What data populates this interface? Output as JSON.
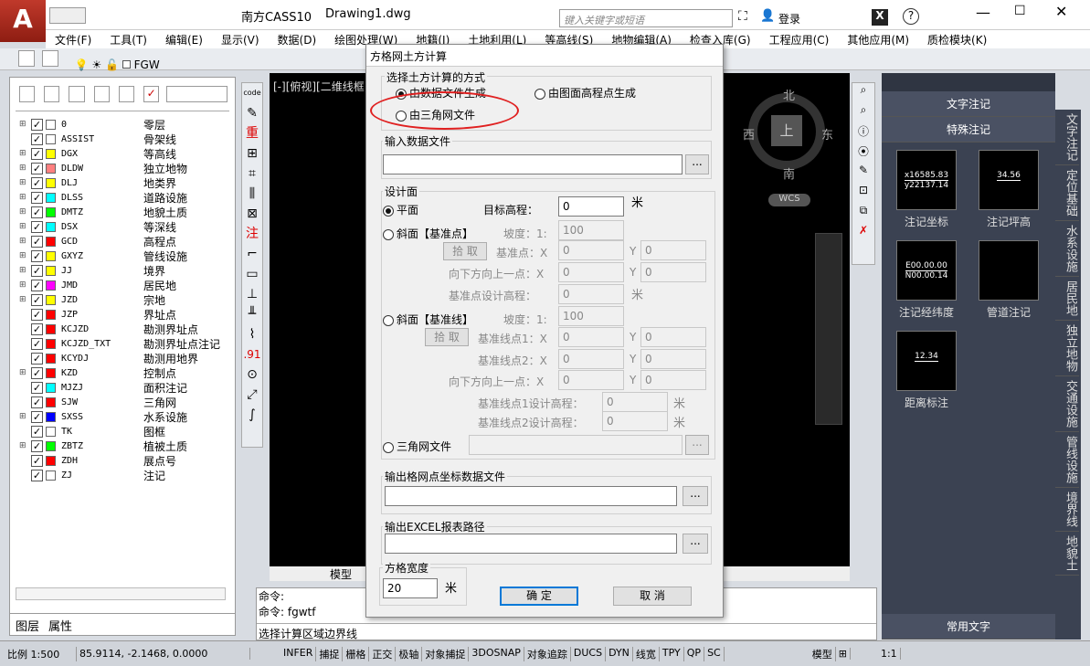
{
  "app": {
    "title": "南方CASS10",
    "file": "Drawing1.dwg",
    "search_placeholder": "键入关键字或短语",
    "login": "登录"
  },
  "menus": [
    "文件(F)",
    "工具(T)",
    "编辑(E)",
    "显示(V)",
    "数据(D)",
    "绘图处理(W)",
    "地籍(J)",
    "土地利用(L)",
    "等高线(S)",
    "地物编辑(A)",
    "检查入库(G)",
    "工程应用(C)",
    "其他应用(M)",
    "质检模块(K)"
  ],
  "layer_combo": "FGW",
  "layers": [
    {
      "name": "0",
      "desc": "零层",
      "color": "#ffffff",
      "plus": true
    },
    {
      "name": "ASSIST",
      "desc": "骨架线",
      "color": "#ffffff",
      "plus": false
    },
    {
      "name": "DGX",
      "desc": "等高线",
      "color": "#ffff00",
      "plus": true
    },
    {
      "name": "DLDW",
      "desc": "独立地物",
      "color": "#ff8080",
      "plus": true
    },
    {
      "name": "DLJ",
      "desc": "地类界",
      "color": "#ffff00",
      "plus": true
    },
    {
      "name": "DLSS",
      "desc": "道路设施",
      "color": "#00ffff",
      "plus": true
    },
    {
      "name": "DMTZ",
      "desc": "地貌土质",
      "color": "#00ff00",
      "plus": true
    },
    {
      "name": "DSX",
      "desc": "等深线",
      "color": "#00ffff",
      "plus": true
    },
    {
      "name": "GCD",
      "desc": "高程点",
      "color": "#ff0000",
      "plus": true
    },
    {
      "name": "GXYZ",
      "desc": "管线设施",
      "color": "#ffff00",
      "plus": true
    },
    {
      "name": "JJ",
      "desc": "境界",
      "color": "#ffff00",
      "plus": true
    },
    {
      "name": "JMD",
      "desc": "居民地",
      "color": "#ff00ff",
      "plus": true
    },
    {
      "name": "JZD",
      "desc": "宗地",
      "color": "#ffff00",
      "plus": true
    },
    {
      "name": "JZP",
      "desc": "界址点",
      "color": "#ff0000",
      "plus": false
    },
    {
      "name": "KCJZD",
      "desc": "勘测界址点",
      "color": "#ff0000",
      "plus": false
    },
    {
      "name": "KCJZD_TXT",
      "desc": "勘测界址点注记",
      "color": "#ff0000",
      "plus": false
    },
    {
      "name": "KCYDJ",
      "desc": "勘测用地界",
      "color": "#ff0000",
      "plus": false
    },
    {
      "name": "KZD",
      "desc": "控制点",
      "color": "#ff0000",
      "plus": true
    },
    {
      "name": "MJZJ",
      "desc": "面积注记",
      "color": "#00ffff",
      "plus": false
    },
    {
      "name": "SJW",
      "desc": "三角网",
      "color": "#ff0000",
      "plus": false
    },
    {
      "name": "SXSS",
      "desc": "水系设施",
      "color": "#0000ff",
      "plus": true
    },
    {
      "name": "TK",
      "desc": "图框",
      "color": "#ffffff",
      "plus": false
    },
    {
      "name": "ZBTZ",
      "desc": "植被土质",
      "color": "#00ff00",
      "plus": true
    },
    {
      "name": "ZDH",
      "desc": "展点号",
      "color": "#ff0000",
      "plus": false
    },
    {
      "name": "ZJ",
      "desc": "注记",
      "color": "#ffffff",
      "plus": false
    }
  ],
  "left_tabs": {
    "layers": "图层",
    "props": "属性"
  },
  "viewport": {
    "label": "[-][俯视][二维线框]",
    "tab_model": "模型"
  },
  "viewcube": {
    "north": "北",
    "south": "南",
    "east": "东",
    "west": "西",
    "top": "上",
    "wcs": "WCS"
  },
  "dialog": {
    "title": "方格网土方计算",
    "method_group": "选择土方计算的方式",
    "opt_data_file": "由数据文件生成",
    "opt_elev_points": "由图面高程点生成",
    "opt_tin_file": "由三角网文件",
    "input_group": "输入数据文件",
    "browse": "...",
    "design_group": "设计面",
    "plane": "平面",
    "target_elev": "目标高程：",
    "target_elev_val": "0",
    "unit_m": "米",
    "slope_base_point": "斜面【基准点】",
    "slope_label": "坡度：1:",
    "slope_val": "100",
    "pick": "拾 取",
    "base_point": "基准点：X",
    "y_label": "Y",
    "zero": "0",
    "down_point": "向下方向上一点：X",
    "base_point_design": "基准点设计高程：",
    "slope_base_line": "斜面【基准线】",
    "base_line1": "基准线点1：X",
    "base_line2": "基准线点2：X",
    "base_line1_design": "基准线点1设计高程：",
    "base_line2_design": "基准线点2设计高程：",
    "tin_file": "三角网文件",
    "output_grid_group": "输出格网点坐标数据文件",
    "output_excel_group": "输出EXCEL报表路径",
    "grid_width_group": "方格宽度",
    "grid_width_val": "20",
    "ok": "确 定",
    "cancel": "取 消"
  },
  "command": {
    "line1": "命令:",
    "line2": "命令: fgwtf",
    "prompt": "选择计算区域边界线"
  },
  "status": {
    "scale": "比例  1:500",
    "coords": "85.9114,  -2.1468, 0.0000",
    "toggles": [
      "INFER",
      "捕捉",
      "栅格",
      "正交",
      "极轴",
      "对象捕捉",
      "3DOSNAP",
      "对象追踪",
      "DUCS",
      "DYN",
      "线宽",
      "TPY",
      "QP",
      "SC"
    ],
    "model": "模型",
    "anno": "1:1"
  },
  "right_panel": {
    "text_anno": "文字注记",
    "special_anno": "特殊注记",
    "common_text": "常用文字",
    "tiles": [
      {
        "label": "注记坐标",
        "line1": "x16585.83",
        "line2": "y22137.14"
      },
      {
        "label": "注记坪高",
        "line1": "34.56",
        "line2": ""
      },
      {
        "label": "注记经纬度",
        "line1": "E00.00.00",
        "line2": "N00.00.14"
      },
      {
        "label": "管道注记",
        "line1": "",
        "line2": ""
      },
      {
        "label": "距离标注",
        "line1": "12.34",
        "line2": ""
      }
    ],
    "side_tabs": [
      "文字注记",
      "定位基础",
      "水系设施",
      "居民地",
      "独立地物",
      "交通设施",
      "管线设施",
      "境界线",
      "地貌土"
    ]
  },
  "vtool_labels": [
    "code",
    "重",
    "注",
    ".91"
  ]
}
